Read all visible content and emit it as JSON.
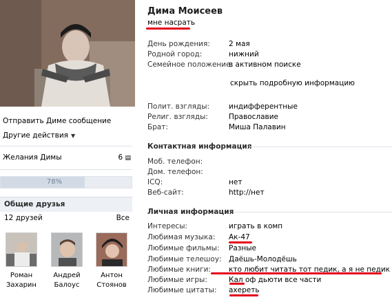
{
  "profile": {
    "name": "Дима Моисеев",
    "status": "мне насрать"
  },
  "left": {
    "send_message": "Отправить Диме сообщение",
    "other_actions": "Другие действия",
    "wishes_label": "Желания Димы",
    "wishes_count": "6",
    "progress_percent": 78,
    "progress_label": "78%",
    "friends_title": "Общие друзья",
    "friends_count": "12 друзей",
    "friends_all": "Все",
    "friends": [
      {
        "first": "Роман",
        "last": "Захарин"
      },
      {
        "first": "Андрей",
        "last": "Балоус"
      },
      {
        "first": "Антон",
        "last": "Стоянов"
      }
    ]
  },
  "info": [
    {
      "key": "День рождения:",
      "value": "2 мая"
    },
    {
      "key": "Родной город:",
      "value": "нижний"
    },
    {
      "key": "Семейное положение:",
      "value": "в активном поиске"
    }
  ],
  "hide_link": "скрыть подробную информацию",
  "views": [
    {
      "key": "Полит. взгляды:",
      "value": "индифферентные"
    },
    {
      "key": "Религ. взгляды:",
      "value": "Православие"
    },
    {
      "key": "Брат:",
      "value": "Миша Палавин"
    }
  ],
  "contact_title": "Контактная информация",
  "contacts": [
    {
      "key": "Моб. телефон:",
      "value": ""
    },
    {
      "key": "Дом. телефон:",
      "value": ""
    },
    {
      "key": "ICQ:",
      "value": "нет"
    },
    {
      "key": "Веб-сайт:",
      "value": "http://нет"
    }
  ],
  "personal_title": "Личная информация",
  "personal": [
    {
      "key": "Интересы:",
      "value": "играть в комп"
    },
    {
      "key": "Любимая музыка:",
      "value": "Ак-47"
    },
    {
      "key": "Любимые фильмы:",
      "value": "Разные"
    },
    {
      "key": "Любимые телешоу:",
      "value": "Даёшь-Молодёшь"
    },
    {
      "key": "Любимые книги:",
      "value": "кто любит читать тот педик, а я не педик"
    },
    {
      "key": "Любимые игры:",
      "value": "Кал оф дьюти все части"
    },
    {
      "key": "Любимые цитаты:",
      "value": "ахерeть"
    }
  ],
  "colors": {
    "highlight_red": "#e3001b",
    "section_line": "#dde3ea"
  }
}
